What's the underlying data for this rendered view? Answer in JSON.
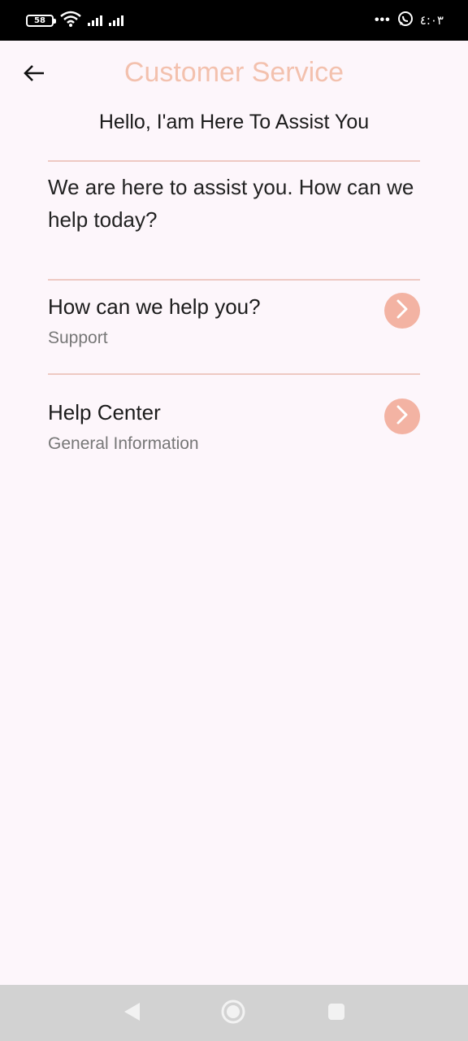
{
  "status_bar": {
    "battery": "58",
    "time": "٤:٠٣",
    "overflow": "•••",
    "icons": [
      "battery-icon",
      "wifi-icon",
      "signal-icon",
      "signal-icon",
      "whatsapp-icon"
    ]
  },
  "header": {
    "title": "Customer Service",
    "subtitle": "Hello, I'am Here To Assist You",
    "back_icon": "arrow-left-icon"
  },
  "intro": {
    "text": "We are here to assist you. How can we help today?"
  },
  "items": [
    {
      "title": "How can we help you?",
      "subtitle": "Support",
      "icon": "chevron-right-icon"
    },
    {
      "title": "Help Center",
      "subtitle": "General Information",
      "icon": "chevron-right-icon"
    }
  ],
  "nav_bar": {
    "icons": [
      "nav-back-icon",
      "nav-home-icon",
      "nav-recents-icon"
    ]
  },
  "colors": {
    "accent": "#f3c1ae",
    "chevron_bg": "#f3b3a3",
    "divider": "#eec9c3",
    "background": "#fdf6fb"
  }
}
